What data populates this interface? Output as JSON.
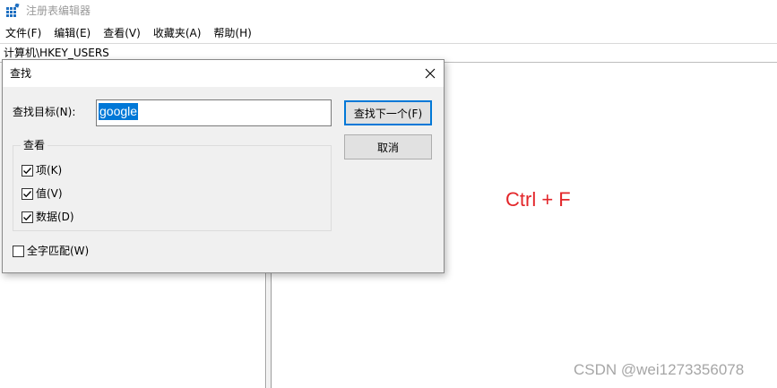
{
  "window": {
    "title": "注册表编辑器"
  },
  "menu": [
    {
      "label": "文件(F)"
    },
    {
      "label": "编辑(E)"
    },
    {
      "label": "查看(V)"
    },
    {
      "label": "收藏夹(A)"
    },
    {
      "label": "帮助(H)"
    }
  ],
  "address": {
    "path": "计算机\\HKEY_USERS"
  },
  "dialog": {
    "title": "查找",
    "find_label": "查找目标(N):",
    "find_value": "google",
    "find_next_label": "查找下一个(F)",
    "cancel_label": "取消",
    "group_label": "查看",
    "options": {
      "keys": {
        "label": "项(K)",
        "checked": true
      },
      "values": {
        "label": "值(V)",
        "checked": true
      },
      "data": {
        "label": "数据(D)",
        "checked": true
      }
    },
    "whole_string": {
      "label": "全字匹配(W)",
      "checked": false
    }
  },
  "annotation": {
    "text": "Ctrl + F",
    "color": "#e3262a"
  },
  "watermark": {
    "text": "CSDN @wei1273356078"
  },
  "colors": {
    "selection": "#0078d7",
    "dialog_bg": "#f0f0f0"
  }
}
